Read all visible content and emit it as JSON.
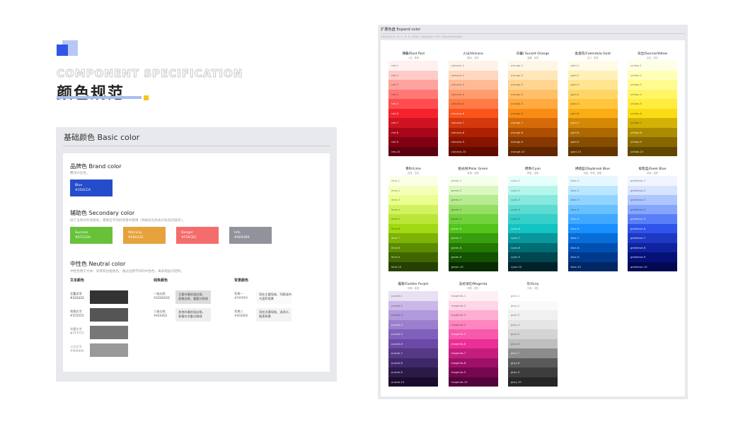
{
  "header": {
    "spec_text": "COMPONENT SPECIFICATION",
    "title": "颜色规范"
  },
  "basic": {
    "title": "基础颜色   Basic color",
    "brand": {
      "title": "品牌色 Brand color",
      "desc": "腾讯VI主色。",
      "swatch": {
        "name": "Blue",
        "hex": "#254CCA",
        "color": "#254CCA"
      }
    },
    "secondary": {
      "title": "辅助色 Secondary color",
      "desc": "除了主色外的场景色，需要在不同的场景中使用（例如危险色表示危险的操作）。",
      "swatches": [
        {
          "name": "Success",
          "hex": "#67C23A",
          "color": "#67C23A"
        },
        {
          "name": "Warning",
          "hex": "#E6A23C",
          "color": "#E6A23C"
        },
        {
          "name": "Danger",
          "hex": "#F56C6C",
          "color": "#F56C6C"
        },
        {
          "name": "Info",
          "hex": "#909399",
          "color": "#909399"
        }
      ]
    },
    "neutral": {
      "title": "中性色 Neutral color",
      "desc": "中性色用于文本、背景和边框颜色。通过运用不同的中性色，来表现层次结构。",
      "text_col": {
        "title": "文本颜色",
        "items": [
          {
            "name": "主要文字",
            "hex": "#333333",
            "color": "#333333"
          },
          {
            "name": "常规文字",
            "hex": "#555555",
            "color": "#555555"
          },
          {
            "name": "次要文字",
            "hex": "#777777",
            "color": "#777777"
          },
          {
            "name": "占位文字",
            "hex": "#999999",
            "color": "#999999"
          }
        ]
      },
      "border_col": {
        "title": "线条颜色",
        "items": [
          {
            "name": "一级边框",
            "hex": "#DDDDDD",
            "note1": "主要外看检组边框，",
            "note2": "表格边框，重要分割线",
            "color": "#DDDDDD"
          },
          {
            "name": "二级边框",
            "hex": "#EEEEEE",
            "note1": "其他外看检组边框，",
            "note2": "表格外次重分割线",
            "color": "#EEEEEE"
          }
        ]
      },
      "bg_col": {
        "title": "背景颜色",
        "items": [
          {
            "name": "背景一",
            "hex": "#F9F9F9",
            "note1": "用在主要导航、列表选中、",
            "note2": "大面积背景",
            "color": "#F9F9F9"
          },
          {
            "name": "背景二",
            "hex": "#EEEEEE",
            "note1": "用在次要导航、选项卡、",
            "note2": "图表背景",
            "color": "#F3F3F3"
          }
        ]
      }
    }
  },
  "expand": {
    "title": "扩展色盘   Expand color",
    "desc": "扩展色盘包含了红、橙、黄、绿、蓝、紫等颜色，每种颜色提供10个色阶，满足更多的场景使用需求。",
    "palettes": [
      {
        "name": "薄暮/Dust Red",
        "desc": "斗志、奔放",
        "prefix": "red",
        "colors": [
          "#fff1f0",
          "#ffccc7",
          "#ffa39e",
          "#ff7875",
          "#ff4d4f",
          "#f5222d",
          "#cf1322",
          "#a8071a",
          "#820014",
          "#5c0011"
        ]
      },
      {
        "name": "火山/Volcano",
        "desc": "醒目、澎湃",
        "prefix": "volcano",
        "colors": [
          "#fff2e8",
          "#ffd8bf",
          "#ffbb96",
          "#ff9c6e",
          "#ff7a45",
          "#fa541c",
          "#d4380d",
          "#ad2102",
          "#871400",
          "#610b00"
        ]
      },
      {
        "name": "日暮/ Sunset Orange",
        "desc": "温暖、欢快",
        "prefix": "orange",
        "colors": [
          "#fff7e6",
          "#ffe7ba",
          "#ffd591",
          "#ffc069",
          "#ffa940",
          "#fa8c16",
          "#d46b08",
          "#ad4e00",
          "#873800",
          "#612500"
        ]
      },
      {
        "name": "金盏花/Calendula Gold",
        "desc": "活力、积极",
        "prefix": "gold",
        "colors": [
          "#fffbe6",
          "#fff1b8",
          "#ffe58f",
          "#ffd666",
          "#ffc53d",
          "#faad14",
          "#d48806",
          "#ad6800",
          "#874d00",
          "#613400"
        ]
      },
      {
        "name": "日出/SunriseYellow",
        "desc": "出生、阳光",
        "prefix": "yellow",
        "colors": [
          "#feffe6",
          "#ffffb8",
          "#fffb8f",
          "#fff566",
          "#ffec3d",
          "#fadb14",
          "#d4b106",
          "#ad8b00",
          "#876800",
          "#614700"
        ]
      },
      {
        "name": "青柠/Lime",
        "desc": "自然、生机",
        "prefix": "lime",
        "colors": [
          "#fcffe6",
          "#f4ffb8",
          "#eaff8f",
          "#d3f261",
          "#bae637",
          "#a0d911",
          "#7cb305",
          "#5b8c00",
          "#3f6600",
          "#254000"
        ]
      },
      {
        "name": "极光绿/Polar Green",
        "desc": "健康、创新",
        "prefix": "green",
        "colors": [
          "#f6ffed",
          "#d9f7be",
          "#b7eb8f",
          "#95de64",
          "#73d13d",
          "#52c41a",
          "#389e0d",
          "#237804",
          "#135200",
          "#092b00"
        ]
      },
      {
        "name": "明青/Cyan",
        "desc": "希望、坚强",
        "prefix": "cyan",
        "colors": [
          "#e6fffb",
          "#b5f5ec",
          "#87e8de",
          "#5cdbd3",
          "#36cfc9",
          "#13c2c2",
          "#08979c",
          "#006d75",
          "#00474f",
          "#002329"
        ]
      },
      {
        "name": "拂晓蓝/Daybreak Blue",
        "desc": "包容、科技、普惠",
        "prefix": "blue",
        "colors": [
          "#e6f7ff",
          "#bae7ff",
          "#91d5ff",
          "#69c0ff",
          "#40a9ff",
          "#1890ff",
          "#096dd9",
          "#0050b3",
          "#003a8c",
          "#002766"
        ]
      },
      {
        "name": "极客蓝/Geek Blue",
        "desc": "探索、钻研",
        "prefix": "geekblue",
        "colors": [
          "#f0f5ff",
          "#d6e4ff",
          "#adc6ff",
          "#85a5ff",
          "#597ef7",
          "#2f54eb",
          "#1d39c4",
          "#10239e",
          "#061178",
          "#030852"
        ]
      },
      {
        "name": "酱紫/Golden Purple",
        "desc": "优雅、浪漫",
        "prefix": "purple",
        "colors": [
          "#e8e1f3",
          "#cbb8e8",
          "#b19bdc",
          "#9b7fcd",
          "#8060bd",
          "#6a4aa6",
          "#553886",
          "#3f2867",
          "#2b1947",
          "#190c2c"
        ]
      },
      {
        "name": "法式洋红/Magenta",
        "desc": "明快、感性",
        "prefix": "magenta",
        "colors": [
          "#fff0f6",
          "#ffd6e7",
          "#ffadd2",
          "#ff85c0",
          "#f759ab",
          "#eb2f96",
          "#c41d7f",
          "#9e1068",
          "#780650",
          "#520339"
        ]
      },
      {
        "name": "灰/Grey",
        "desc": "平和、中性",
        "prefix": "grey",
        "colors": [
          "#ffffff",
          "#fafafa",
          "#f0f0f0",
          "#e5e5e5",
          "#d4d4d4",
          "#bfbfbf",
          "#8c8c8c",
          "#595959",
          "#3d3d3d",
          "#262626"
        ]
      }
    ]
  }
}
